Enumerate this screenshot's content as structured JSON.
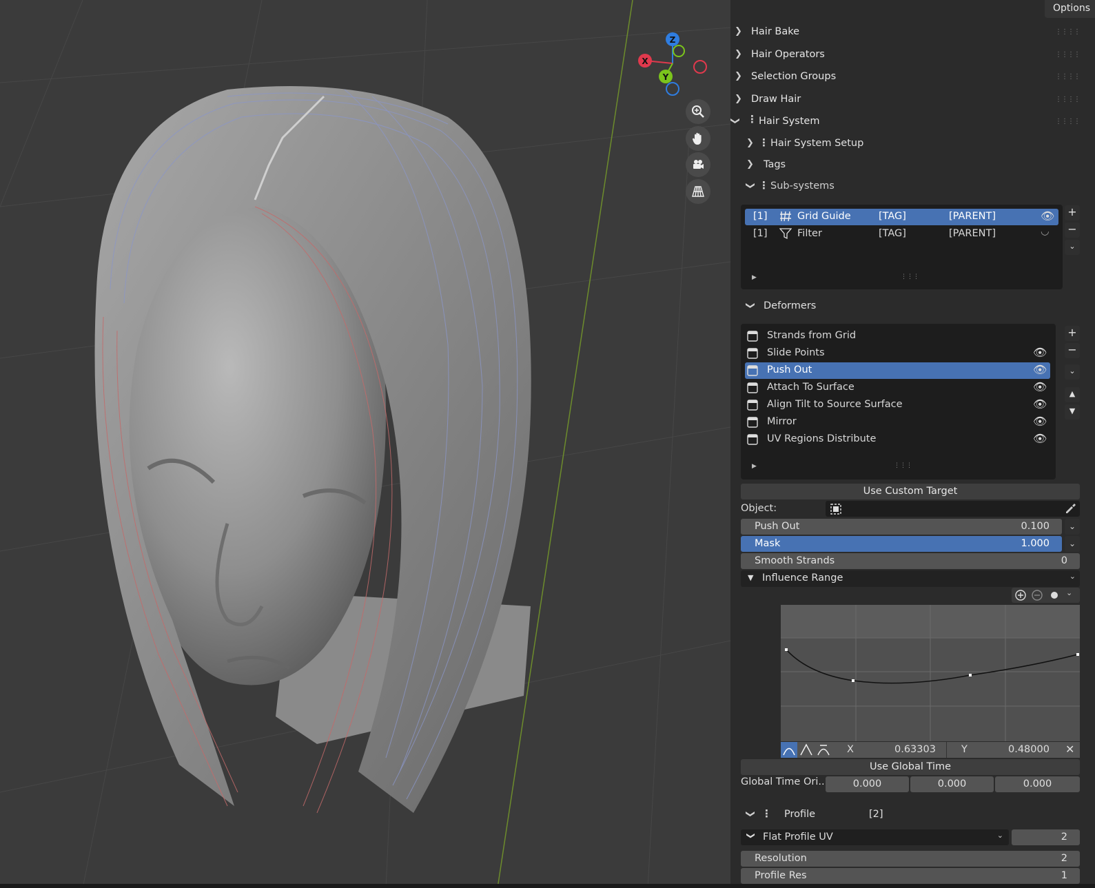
{
  "options_label": "Options",
  "panels": {
    "hair_bake": "Hair Bake",
    "hair_operators": "Hair Operators",
    "selection_groups": "Selection Groups",
    "draw_hair": "Draw Hair",
    "hair_system": "Hair System"
  },
  "hair_system": {
    "setup": "Hair System Setup",
    "tags": "Tags",
    "subsystems": "Sub-systems",
    "subsystem_list": [
      {
        "index": "[1]",
        "name": "Grid Guide",
        "tag": "[TAG]",
        "parent": "[PARENT]",
        "icon": "grid-icon",
        "selected": true
      },
      {
        "index": "[1]",
        "name": "Filter",
        "tag": "[TAG]",
        "parent": "[PARENT]",
        "icon": "filter-icon",
        "selected": false
      }
    ]
  },
  "deformers": {
    "title": "Deformers",
    "items": [
      {
        "name": "Strands from Grid",
        "visible": false,
        "selected": false
      },
      {
        "name": "Slide Points",
        "visible": true,
        "selected": false
      },
      {
        "name": "Push Out",
        "visible": true,
        "selected": true
      },
      {
        "name": "Attach To Surface",
        "visible": true,
        "selected": false
      },
      {
        "name": "Align Tilt to Source Surface",
        "visible": true,
        "selected": false
      },
      {
        "name": "Mirror",
        "visible": true,
        "selected": false
      },
      {
        "name": "UV Regions Distribute",
        "visible": true,
        "selected": false
      }
    ]
  },
  "props": {
    "use_custom_target": "Use Custom Target",
    "object_label": "Object:",
    "push_out": {
      "label": "Push Out",
      "value": "0.100"
    },
    "mask": {
      "label": "Mask",
      "value": "1.000"
    },
    "smooth_strands": {
      "label": "Smooth Strands",
      "value": "0"
    },
    "influence_range": "Influence Range",
    "curve_x_label": "X",
    "curve_x": "0.63303",
    "curve_y_label": "Y",
    "curve_y": "0.48000",
    "use_global_time": "Use Global Time",
    "global_time_label": "Global Time Ori...",
    "global_time": [
      "0.000",
      "0.000",
      "0.000"
    ]
  },
  "profile": {
    "title": "Profile",
    "count": "[2]",
    "type": "Flat Profile UV",
    "type_value": "2",
    "resolution": {
      "label": "Resolution",
      "value": "2"
    },
    "profile_res": {
      "label": "Profile Res",
      "value": "1"
    }
  },
  "gizmo": {
    "x": "X",
    "y": "Y",
    "z": "Z"
  },
  "colors": {
    "accent": "#4772b3",
    "x_axis": "#e0394d",
    "y_axis": "#7bc41c",
    "z_axis": "#2f7de0"
  }
}
